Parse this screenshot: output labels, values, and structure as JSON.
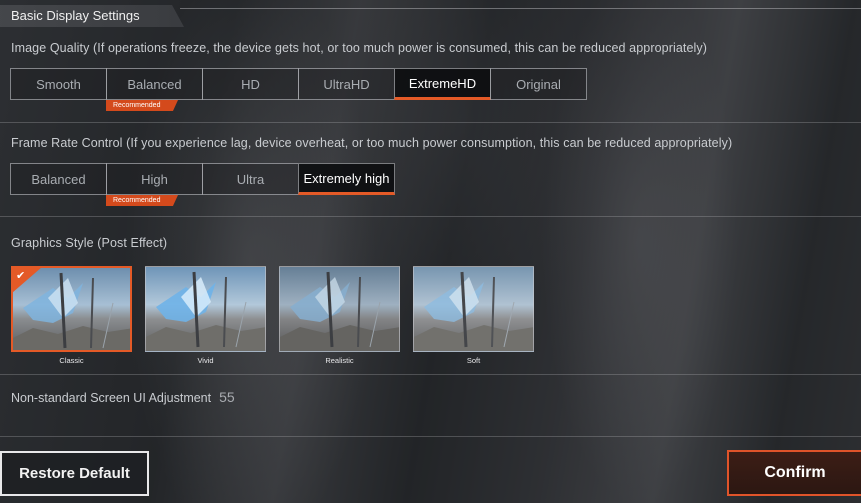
{
  "section_title": "Basic Display Settings",
  "image_quality": {
    "label": "Image Quality (If operations freeze, the device gets hot, or too much power is consumed, this can be reduced appropriately)",
    "options": [
      "Smooth",
      "Balanced",
      "HD",
      "UltraHD",
      "ExtremeHD",
      "Original"
    ],
    "selected": "ExtremeHD",
    "recommended": "Balanced",
    "recommended_label": "Recommended"
  },
  "frame_rate": {
    "label": "Frame Rate Control (If you experience lag, device overheat, or too much power consumption, this can be reduced appropriately)",
    "options": [
      "Balanced",
      "High",
      "Ultra",
      "Extremely high"
    ],
    "selected": "Extremely high",
    "recommended": "High",
    "recommended_label": "Recommended"
  },
  "graphics_style": {
    "label": "Graphics Style (Post Effect)",
    "options": [
      {
        "name": "Classic",
        "selected": true
      },
      {
        "name": "Vivid",
        "selected": false
      },
      {
        "name": "Realistic",
        "selected": false
      },
      {
        "name": "Soft",
        "selected": false
      }
    ],
    "check_icon": "checkmark-icon"
  },
  "nonstandard_ui": {
    "label": "Non-standard Screen UI Adjustment",
    "value": "55"
  },
  "buttons": {
    "restore": "Restore Default",
    "confirm": "Confirm"
  },
  "colors": {
    "accent": "#e45a27"
  }
}
